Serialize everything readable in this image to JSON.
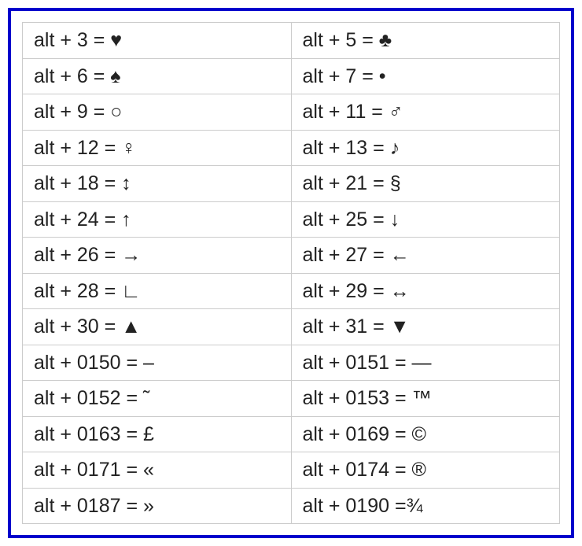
{
  "alt_codes": {
    "rows": [
      {
        "left_code": "alt + 3 = ",
        "left_symbol": "♥",
        "right_code": "alt + 5 = ",
        "right_symbol": "♣"
      },
      {
        "left_code": "alt + 6 = ",
        "left_symbol": "♠",
        "right_code": "alt + 7 = ",
        "right_symbol": "•"
      },
      {
        "left_code": "alt + 9 = ",
        "left_symbol": "○",
        "right_code": "alt + 11 = ",
        "right_symbol": "♂"
      },
      {
        "left_code": "alt + 12 = ",
        "left_symbol": "♀",
        "right_code": "alt + 13 = ",
        "right_symbol": "♪"
      },
      {
        "left_code": "alt + 18 = ",
        "left_symbol": "↕",
        "right_code": "alt + 21 = ",
        "right_symbol": "§"
      },
      {
        "left_code": "alt + 24 = ",
        "left_symbol": "↑",
        "right_code": "alt + 25 = ",
        "right_symbol": "↓"
      },
      {
        "left_code": "alt + 26 = ",
        "left_symbol": "→",
        "right_code": "alt + 27 = ",
        "right_symbol": "←"
      },
      {
        "left_code": "alt + 28 = ",
        "left_symbol": "∟",
        "right_code": "alt + 29 = ",
        "right_symbol": "↔"
      },
      {
        "left_code": "alt + 30 = ",
        "left_symbol": "▲",
        "right_code": "alt + 31 = ",
        "right_symbol": "▼"
      },
      {
        "left_code": "alt + 0150 = ",
        "left_symbol": "–",
        "right_code": "alt + 0151 = ",
        "right_symbol": "—"
      },
      {
        "left_code": "alt + 0152 = ",
        "left_symbol": "˜",
        "right_code": "alt + 0153 = ",
        "right_symbol": "™"
      },
      {
        "left_code": "alt + 0163 = ",
        "left_symbol": "£",
        "right_code": "alt + 0169 = ",
        "right_symbol": "©"
      },
      {
        "left_code": "alt + 0171 = ",
        "left_symbol": "«",
        "right_code": "alt + 0174 = ",
        "right_symbol": "®"
      },
      {
        "left_code": "alt + 0187 = ",
        "left_symbol": "»",
        "right_code": "alt + 0190 =",
        "right_symbol": "¾"
      }
    ]
  }
}
